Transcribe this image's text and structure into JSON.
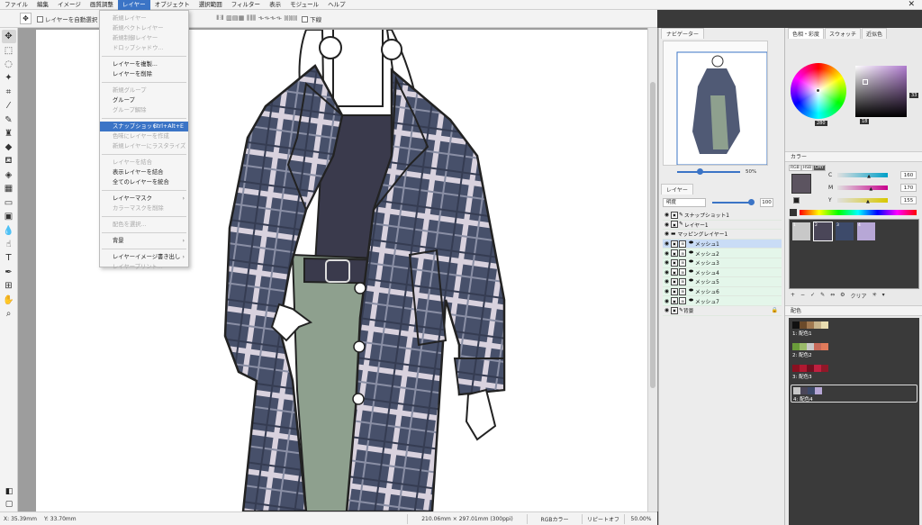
{
  "menubar": {
    "items": [
      "ファイル",
      "編集",
      "イメージ",
      "画質調整",
      "レイヤー",
      "オブジェクト",
      "選択範囲",
      "フィルター",
      "表示",
      "モジュール",
      "ヘルプ"
    ],
    "active_index": 4,
    "close_glyph": "✕"
  },
  "tool_options": {
    "auto_select_label": "レイヤーを自動選択",
    "last_label": "下線"
  },
  "tools": [
    "move-icon",
    "marquee-icon",
    "lasso-icon",
    "magic-wand-icon",
    "crop-icon",
    "eyedropper-icon",
    "brush-icon",
    "stamp-icon",
    "eraser-icon",
    "fill-icon",
    "gradient-fill-icon",
    "pattern-icon",
    "rectangle-icon",
    "mapping-icon",
    "drop-icon",
    "smudge-icon",
    "text-icon",
    "pen-icon",
    "mesh-icon",
    "hand-icon",
    "zoom-icon"
  ],
  "layer_menu": {
    "items": [
      {
        "label": "新規レイヤー",
        "disabled": true
      },
      {
        "label": "新規ベクトレイヤー",
        "disabled": true
      },
      {
        "label": "新規制御レイヤー",
        "disabled": true
      },
      {
        "label": "ドロップシャドウ...",
        "disabled": true
      },
      {
        "sep": true
      },
      {
        "label": "レイヤーを複製...",
        "disabled": false
      },
      {
        "label": "レイヤーを削除",
        "disabled": false
      },
      {
        "sep": true
      },
      {
        "label": "新規グループ",
        "disabled": true
      },
      {
        "label": "グループ",
        "disabled": false
      },
      {
        "label": "グループ解除",
        "disabled": true
      },
      {
        "sep": true
      },
      {
        "label": "スナップショット",
        "shortcut": "Ctrl+Alt+E",
        "highlight": true
      },
      {
        "label": "色味にレイヤーを作成",
        "disabled": true
      },
      {
        "label": "新規レイヤーにラスタライズ",
        "disabled": true
      },
      {
        "sep": true
      },
      {
        "label": "レイヤーを結合",
        "disabled": true
      },
      {
        "label": "表示レイヤーを結合",
        "disabled": false
      },
      {
        "label": "全てのレイヤーを統合",
        "disabled": false
      },
      {
        "sep": true
      },
      {
        "label": "レイヤーマスク",
        "disabled": false,
        "submenu": true
      },
      {
        "label": "カラーマスクを削除",
        "disabled": true
      },
      {
        "sep": true
      },
      {
        "label": "配色を選択...",
        "disabled": true
      },
      {
        "sep": true
      },
      {
        "label": "背景",
        "disabled": false,
        "submenu": true
      },
      {
        "sep": true
      },
      {
        "label": "レイヤーイメージ書き出し",
        "disabled": false,
        "submenu": true
      },
      {
        "label": "レイヤープリント...",
        "disabled": true
      }
    ]
  },
  "navigator": {
    "tab": "ナビゲーター",
    "zoom": "50%"
  },
  "layers": {
    "tab": "レイヤー",
    "blend_mode": "明度",
    "opacity": "100",
    "items": [
      {
        "name": "スナップショット1",
        "kind": "normal"
      },
      {
        "name": "レイヤー1",
        "kind": "normal"
      },
      {
        "name": "マッピングレイヤー1",
        "kind": "folder"
      },
      {
        "name": "メッシュ1",
        "kind": "mesh",
        "active": true
      },
      {
        "name": "メッシュ2",
        "kind": "mesh"
      },
      {
        "name": "メッシュ3",
        "kind": "mesh"
      },
      {
        "name": "メッシュ4",
        "kind": "mesh"
      },
      {
        "name": "メッシュ5",
        "kind": "mesh"
      },
      {
        "name": "メッシュ6",
        "kind": "mesh"
      },
      {
        "name": "メッシュ7",
        "kind": "mesh"
      },
      {
        "name": "背景",
        "kind": "background"
      }
    ]
  },
  "color_panel": {
    "tabs": [
      "色相・彩度",
      "スウォッチ",
      "近似色"
    ],
    "wheel_value": "280",
    "sv_value_right": "33",
    "sv_value_bottom": "18",
    "sub_tab": "カラー",
    "modes": [
      "RGB",
      "HSB",
      "CMY"
    ],
    "main_color": "#5c5460",
    "cmy": [
      {
        "name": "C",
        "value": "160"
      },
      {
        "name": "M",
        "value": "170"
      },
      {
        "name": "Y",
        "value": "155"
      }
    ],
    "swatches": [
      {
        "label": "1",
        "color": "#c8c8c8"
      },
      {
        "label": "2",
        "color": "#4a4658"
      },
      {
        "label": "3",
        "color": "#3d4a6a"
      },
      {
        "label": "4",
        "color": "#b7a7d6"
      }
    ],
    "swatch_tools_label": "クリア",
    "haishoku_tab": "配色",
    "palettes": [
      {
        "name": "1: 配色1",
        "colors": [
          "#111111",
          "#6b4a2a",
          "#a07850",
          "#c8b48c",
          "#e8dcb0"
        ]
      },
      {
        "name": "2: 配色2",
        "colors": [
          "#6a9c3a",
          "#9aba6a",
          "#c8c8c8",
          "#c86a5a",
          "#e07a5a"
        ]
      },
      {
        "name": "3: 配色3",
        "colors": [
          "#8a1020",
          "#b01830",
          "#701020",
          "#c02040",
          "#901828"
        ]
      },
      {
        "name": "4: 配色4",
        "colors": [
          "#c8c8c8",
          "#4a4658",
          "#3d4a6a",
          "#b7a7d6"
        ]
      }
    ]
  },
  "status": {
    "x_label": "X:",
    "x_value": "35.39mm",
    "y_label": "Y:",
    "y_value": "33.70mm",
    "doc_size": "210.06mm × 297.01mm (300ppi)",
    "color_mode": "RGBカラー",
    "repeat": "リピートオフ",
    "zoom": "50.00%"
  }
}
